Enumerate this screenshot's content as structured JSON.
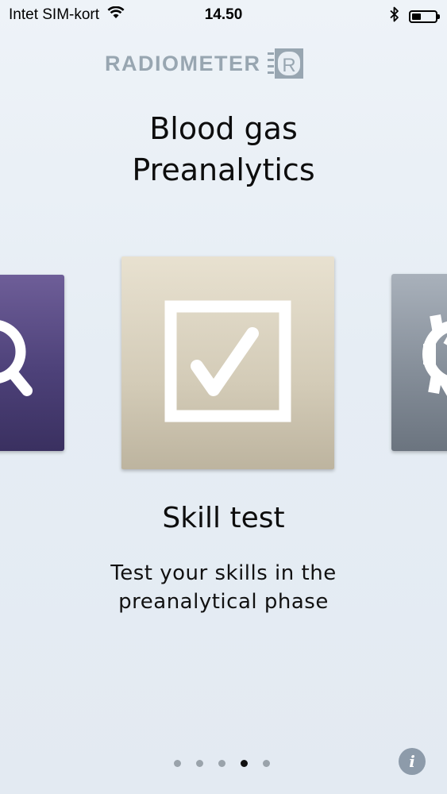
{
  "status_bar": {
    "carrier": "Intet SIM-kort",
    "time": "14.50",
    "battery_level": 0.4
  },
  "logo": {
    "text": "RADIOMETER",
    "mark_letter": "R"
  },
  "app_title": {
    "line1": "Blood gas",
    "line2": "Preanalytics"
  },
  "carousel": {
    "items": [
      {
        "id": "search",
        "icon": "magnifier-icon",
        "color": "#4d4179"
      },
      {
        "id": "skill-test",
        "icon": "checkbox-checked-icon",
        "color": "#d3cbb7"
      },
      {
        "id": "settings",
        "icon": "gear-icon",
        "color": "#858e99"
      }
    ],
    "current": {
      "title": "Skill test",
      "description_line1": "Test your skills in the",
      "description_line2": "preanalytical phase"
    }
  },
  "pagination": {
    "total": 5,
    "active_index": 3
  },
  "info_button": {
    "label": "i"
  }
}
